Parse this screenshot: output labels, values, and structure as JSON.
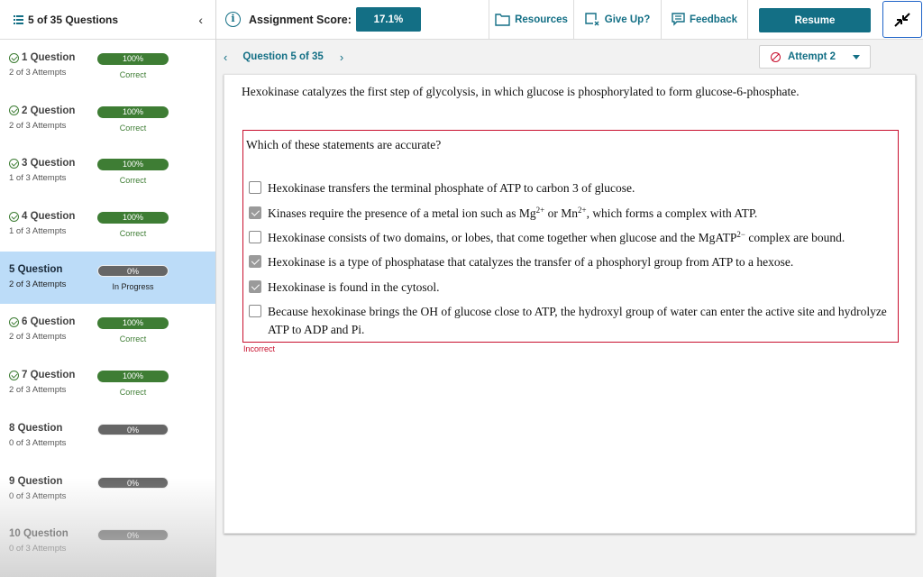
{
  "sidebar": {
    "title": "5 of 35 Questions",
    "items": [
      {
        "label": "1 Question",
        "attempts": "2 of 3 Attempts",
        "score": "100%",
        "status": "Correct",
        "state": "correct"
      },
      {
        "label": "2 Question",
        "attempts": "2 of 3 Attempts",
        "score": "100%",
        "status": "Correct",
        "state": "correct"
      },
      {
        "label": "3 Question",
        "attempts": "1 of 3 Attempts",
        "score": "100%",
        "status": "Correct",
        "state": "correct"
      },
      {
        "label": "4 Question",
        "attempts": "1 of 3 Attempts",
        "score": "100%",
        "status": "Correct",
        "state": "correct"
      },
      {
        "label": "5 Question",
        "attempts": "2 of 3 Attempts",
        "score": "0%",
        "status": "In Progress",
        "state": "active"
      },
      {
        "label": "6 Question",
        "attempts": "2 of 3 Attempts",
        "score": "100%",
        "status": "Correct",
        "state": "correct"
      },
      {
        "label": "7 Question",
        "attempts": "2 of 3 Attempts",
        "score": "100%",
        "status": "Correct",
        "state": "correct"
      },
      {
        "label": "8 Question",
        "attempts": "0 of 3 Attempts",
        "score": "0%",
        "status": "",
        "state": "none"
      },
      {
        "label": "9 Question",
        "attempts": "0 of 3 Attempts",
        "score": "0%",
        "status": "",
        "state": "none"
      },
      {
        "label": "10 Question",
        "attempts": "0 of 3 Attempts",
        "score": "0%",
        "status": "",
        "state": "none"
      }
    ]
  },
  "topbar": {
    "score_label": "Assignment Score:",
    "score_value": "17.1%",
    "resources": "Resources",
    "give_up": "Give Up?",
    "feedback": "Feedback",
    "resume": "Resume"
  },
  "subnav": {
    "question_title": "Question 5 of 35",
    "attempt": "Attempt 2"
  },
  "question": {
    "stem": "Hexokinase catalyzes the first step of glycolysis, in which glucose is phosphorylated to form glucose-6-phosphate.",
    "prompt": "Which of these statements are accurate?",
    "options": [
      {
        "parts": [
          "Hexokinase transfers the terminal phosphate of ATP to carbon 3 of glucose."
        ],
        "checked": false
      },
      {
        "parts": [
          "Kinases require the presence of a metal ion such as Mg",
          "2+",
          " or Mn",
          "2+",
          ", which forms a complex with ATP."
        ],
        "checked": true
      },
      {
        "parts": [
          "Hexokinase consists of two domains, or lobes, that come together when glucose and the MgATP",
          "2−",
          " complex are bound."
        ],
        "checked": false
      },
      {
        "parts": [
          "Hexokinase is a type of phosphatase that catalyzes the transfer of a phosphoryl group from ATP to a hexose."
        ],
        "checked": true
      },
      {
        "parts": [
          "Hexokinase is found in the cytosol."
        ],
        "checked": true
      },
      {
        "parts": [
          "Because hexokinase brings the OH of glucose close to ATP, the hydroxyl group of water can enter the active site and hydrolyze ATP to ADP and Pi."
        ],
        "checked": false
      }
    ],
    "result": "Incorrect"
  }
}
